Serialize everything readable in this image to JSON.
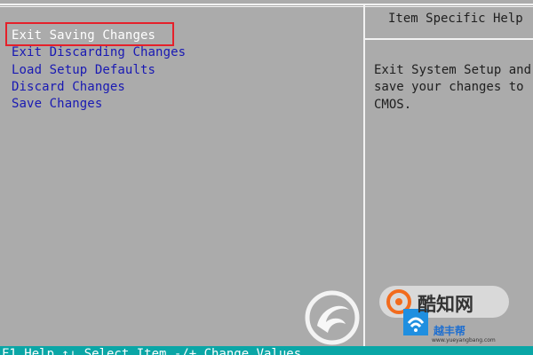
{
  "menu": {
    "items": [
      {
        "label": "Exit Saving Changes",
        "selected": true
      },
      {
        "label": "Exit Discarding Changes",
        "selected": false
      },
      {
        "label": "Load Setup Defaults",
        "selected": false
      },
      {
        "label": "Discard Changes",
        "selected": false
      },
      {
        "label": "Save Changes",
        "selected": false
      }
    ]
  },
  "help": {
    "title": "Item Specific Help",
    "lines": [
      "Exit System Setup and",
      "save your changes to",
      "CMOS."
    ]
  },
  "status_bar": {
    "text": "F1  Help   ↑↓ Select Item   -/+  Change Values"
  },
  "watermark": {
    "text": "酷知网",
    "url": "www.yueyangbang.com",
    "brand": "越丰帮"
  },
  "colors": {
    "background": "#ababab",
    "menu_text": "#1919b3",
    "selected_text": "#ffffff",
    "highlight_border": "#e5202a",
    "help_text": "#202020",
    "status_bar": "#0aa6a6"
  }
}
